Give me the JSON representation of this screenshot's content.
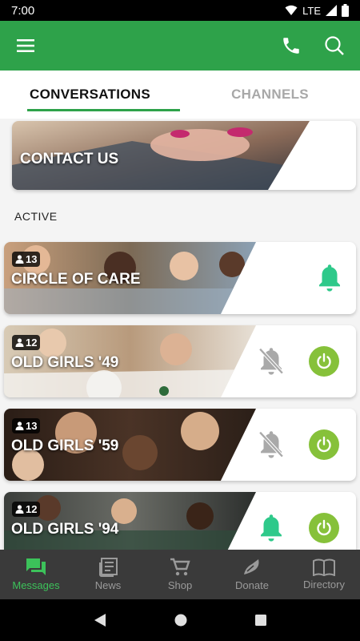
{
  "status_bar": {
    "time": "7:00",
    "network": "LTE"
  },
  "tabs": [
    {
      "label": "CONVERSATIONS",
      "active": true
    },
    {
      "label": "CHANNELS",
      "active": false
    }
  ],
  "contact_card": {
    "title": "CONTACT US"
  },
  "section": {
    "label": "ACTIVE"
  },
  "groups": [
    {
      "title": "CIRCLE OF CARE",
      "count": "13",
      "bell": "on"
    },
    {
      "title": "OLD GIRLS '49",
      "count": "12",
      "bell": "off"
    },
    {
      "title": "OLD GIRLS '59",
      "count": "13",
      "bell": "off"
    },
    {
      "title": "OLD GIRLS '94",
      "count": "12",
      "bell": "on"
    }
  ],
  "bottom_nav": [
    {
      "label": "Messages",
      "icon": "messages-icon"
    },
    {
      "label": "News",
      "icon": "news-icon"
    },
    {
      "label": "Shop",
      "icon": "cart-icon"
    },
    {
      "label": "Donate",
      "icon": "donate-icon"
    },
    {
      "label": "Directory",
      "icon": "book-icon"
    }
  ],
  "colors": {
    "primary": "#2ea24a",
    "bell_active": "#2ec98a",
    "power": "#86c13a",
    "nav_active": "#3cc25a"
  }
}
